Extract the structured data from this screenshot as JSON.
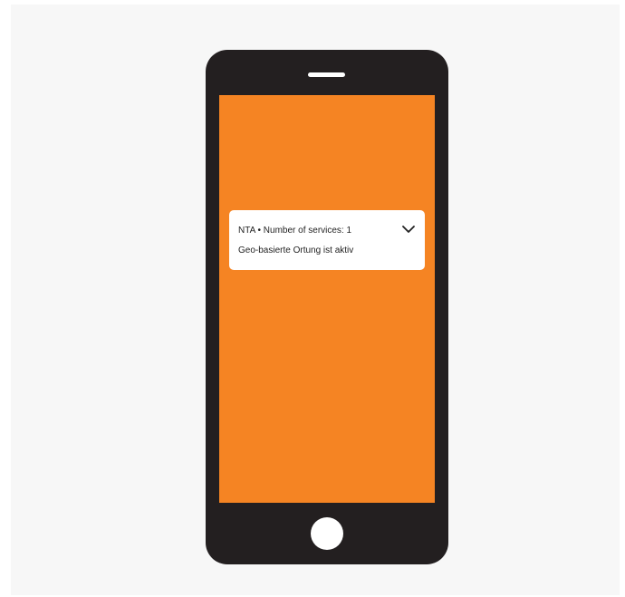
{
  "notification": {
    "app_name": "NTA",
    "separator": "•",
    "summary": "Number of services: 1",
    "body": "Geo-basierte Ortung ist aktiv",
    "expand_icon": "chevron-down-icon"
  },
  "home_button": {
    "icon": "home-button"
  },
  "colors": {
    "screen_background": "#f58423",
    "phone_body": "#231f20",
    "page_background": "#f7f7f7",
    "notification_background": "#ffffff"
  }
}
